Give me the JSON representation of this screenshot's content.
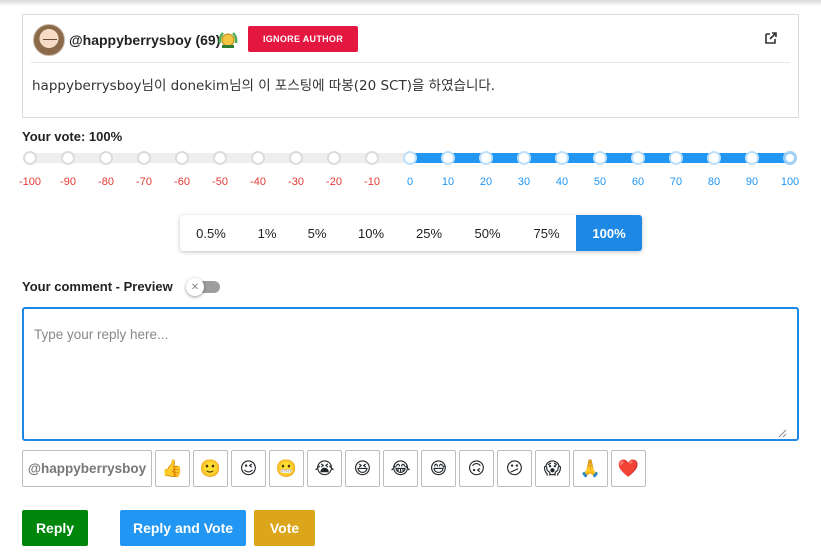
{
  "post": {
    "author": "@happyberrysboy",
    "reputation": "(69)",
    "avatar_icon": "user-avatar",
    "badge_icon": "laurel-badge-icon",
    "ignore_label": "IGNORE AUTHOR",
    "external_icon": "external-link-icon",
    "body": "happyberrysboy님이 donekim님의 이 포스팅에 따봉(20 SCT)을 하였습니다."
  },
  "vote": {
    "label": "Your vote: 100%",
    "value": 100,
    "ticks": [
      "-100",
      "-90",
      "-80",
      "-70",
      "-60",
      "-50",
      "-40",
      "-30",
      "-20",
      "-10",
      "0",
      "10",
      "20",
      "30",
      "40",
      "50",
      "60",
      "70",
      "80",
      "90",
      "100"
    ],
    "colors": {
      "negative": "#e53935",
      "positive": "#2196f3"
    }
  },
  "percent_buttons": {
    "options": [
      "0.5%",
      "1%",
      "5%",
      "10%",
      "25%",
      "50%",
      "75%",
      "100%"
    ],
    "selected": "100%"
  },
  "comment": {
    "label": "Your comment - Preview",
    "preview_toggle": "off",
    "placeholder": "Type your reply here...",
    "value": ""
  },
  "emoji_bar": {
    "mention": "@happyberrysboy",
    "emojis": [
      {
        "name": "thumbs-up-emoji",
        "glyph": "👍"
      },
      {
        "name": "slight-smile-emoji",
        "glyph": "🙂"
      },
      {
        "name": "wink-emoji",
        "glyph": "😉"
      },
      {
        "name": "grimace-emoji",
        "glyph": "😬"
      },
      {
        "name": "crying-emoji",
        "glyph": "😭"
      },
      {
        "name": "squint-laugh-emoji",
        "glyph": "😆"
      },
      {
        "name": "joy-emoji",
        "glyph": "😂"
      },
      {
        "name": "sweat-smile-emoji",
        "glyph": "😅"
      },
      {
        "name": "upside-down-emoji",
        "glyph": "🙃"
      },
      {
        "name": "confused-emoji",
        "glyph": "😕"
      },
      {
        "name": "scream-emoji",
        "glyph": "😱"
      },
      {
        "name": "pray-emoji",
        "glyph": "🙏"
      },
      {
        "name": "heart-emoji",
        "glyph": "❤️"
      }
    ]
  },
  "actions": {
    "reply": "Reply",
    "reply_and_vote": "Reply and Vote",
    "vote": "Vote"
  }
}
